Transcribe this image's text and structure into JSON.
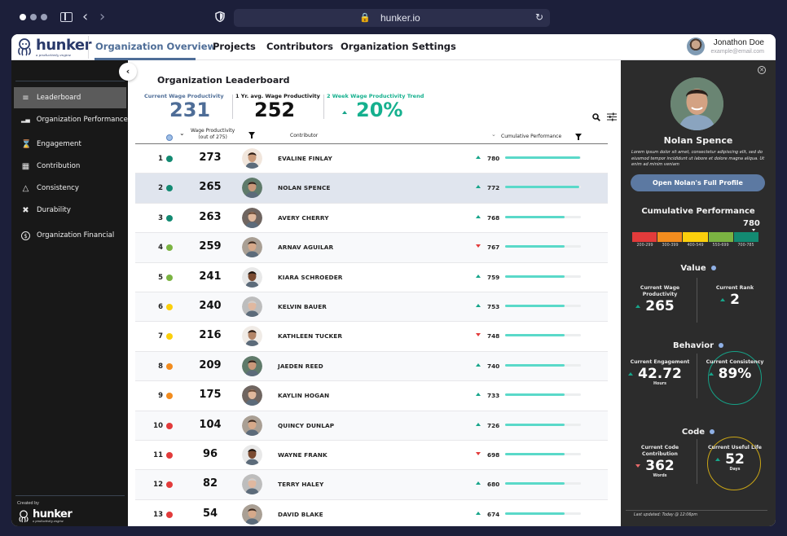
{
  "browser": {
    "url": "hunker.io"
  },
  "app": {
    "logo_text": "hunker",
    "logo_tagline": "a productivity engine",
    "nav": [
      {
        "label": "Organization Overview",
        "active": true
      },
      {
        "label": "Projects",
        "active": false
      },
      {
        "label": "Contributors",
        "active": false
      },
      {
        "label": "Organization Settings",
        "active": false
      }
    ],
    "user": {
      "name": "Jonathon Doe",
      "email": "example@email.com"
    }
  },
  "sidebar": {
    "items": [
      {
        "label": "Leaderboard",
        "icon": "leaderboard-icon",
        "active": true
      },
      {
        "label": "Organization Performance",
        "icon": "bar-chart-icon",
        "active": false
      },
      {
        "label": "Engagement",
        "icon": "hourglass-icon",
        "active": false
      },
      {
        "label": "Contribution",
        "icon": "blocks-icon",
        "active": false
      },
      {
        "label": "Consistency",
        "icon": "metronome-icon",
        "active": false
      },
      {
        "label": "Durability",
        "icon": "durability-icon",
        "active": false
      },
      {
        "label": "Organization Financial",
        "icon": "dollar-circle-icon",
        "active": false
      }
    ],
    "created_by": "Created by",
    "footer_logo": "hunker",
    "footer_tagline": "a productivity engine"
  },
  "main": {
    "title": "Organization Leaderboard",
    "kpis": [
      {
        "label": "Current Wage Productivity",
        "value": "231",
        "color": "#4e6d97"
      },
      {
        "label": "1 Yr. avg. Wage Productivity",
        "value": "252",
        "color": "#111111"
      },
      {
        "label": "2 Week Wage Productivity  Trend",
        "value": "20%",
        "color": "#15b08e",
        "trend": "up"
      }
    ],
    "columns": {
      "wage": "Wage Productivity",
      "wage_sub": "(out of 275)",
      "contributor": "Contributor",
      "performance": "Cumulative Performance"
    },
    "performance_max": 785,
    "rows": [
      {
        "rank": "1",
        "status": "#138a72",
        "wage": "273",
        "name": "EVALINE FINLAY",
        "trend": "up",
        "perf": 780,
        "selected": false
      },
      {
        "rank": "2",
        "status": "#138a72",
        "wage": "265",
        "name": "NOLAN SPENCE",
        "trend": "up",
        "perf": 772,
        "selected": true
      },
      {
        "rank": "3",
        "status": "#138a72",
        "wage": "263",
        "name": "AVERY CHERRY",
        "trend": "up",
        "perf": 768,
        "selected": false
      },
      {
        "rank": "4",
        "status": "#7bb342",
        "wage": "259",
        "name": "ARNAV AGUILAR",
        "trend": "down",
        "perf": 767,
        "selected": false
      },
      {
        "rank": "5",
        "status": "#7bb342",
        "wage": "241",
        "name": "KIARA SCHROEDER",
        "trend": "up",
        "perf": 759,
        "selected": false
      },
      {
        "rank": "6",
        "status": "#fbcf0c",
        "wage": "240",
        "name": "KELVIN BAUER",
        "trend": "up",
        "perf": 753,
        "selected": false
      },
      {
        "rank": "7",
        "status": "#fbcf0c",
        "wage": "216",
        "name": "KATHLEEN TUCKER",
        "trend": "down",
        "perf": 748,
        "selected": false
      },
      {
        "rank": "8",
        "status": "#f28c1e",
        "wage": "209",
        "name": "JAEDEN REED",
        "trend": "up",
        "perf": 740,
        "selected": false
      },
      {
        "rank": "9",
        "status": "#f28c1e",
        "wage": "175",
        "name": "KAYLIN HOGAN",
        "trend": "up",
        "perf": 733,
        "selected": false
      },
      {
        "rank": "10",
        "status": "#e23b3b",
        "wage": "104",
        "name": "QUINCY DUNLAP",
        "trend": "up",
        "perf": 726,
        "selected": false
      },
      {
        "rank": "11",
        "status": "#e23b3b",
        "wage": "96",
        "name": "WAYNE FRANK",
        "trend": "down",
        "perf": 698,
        "selected": false
      },
      {
        "rank": "12",
        "status": "#e23b3b",
        "wage": "82",
        "name": "TERRY HALEY",
        "trend": "up",
        "perf": 680,
        "selected": false
      },
      {
        "rank": "13",
        "status": "#e23b3b",
        "wage": "54",
        "name": "DAVID BLAKE",
        "trend": "up",
        "perf": 674,
        "selected": false
      }
    ]
  },
  "panel": {
    "name": "Nolan Spence",
    "description": "Lorem ipsum dolor sit amet, consectetur adipiscing elit, sed do eiusmod tempor incididunt ut labore et dolore magna aliqua. Ut enim ad minim veniam",
    "profile_button": "Open Nolan's Full Profile",
    "cumulative_title": "Cumulative Performance",
    "cumulative_value": "780",
    "scale": [
      {
        "label": "200-299",
        "color": "#e23b3b"
      },
      {
        "label": "300-399",
        "color": "#f28c1e"
      },
      {
        "label": "400-549",
        "color": "#fbcf0c"
      },
      {
        "label": "550-699",
        "color": "#7bb342"
      },
      {
        "label": "700-785",
        "color": "#138a72"
      }
    ],
    "sections": {
      "value": {
        "title": "Value",
        "left": {
          "label": "Current Wage Productivity",
          "value": "265",
          "trend": "up",
          "unit": ""
        },
        "right": {
          "label": "Current Rank",
          "value": "2",
          "trend": "up",
          "unit": ""
        }
      },
      "behavior": {
        "title": "Behavior",
        "left": {
          "label": "Current Engagement",
          "value": "42.72",
          "trend": "up",
          "unit": "Hours"
        },
        "right": {
          "label": "Current Consistency",
          "value": "89%",
          "trend": "up",
          "unit": "",
          "ring_color": "#16a086"
        }
      },
      "code": {
        "title": "Code",
        "left": {
          "label": "Current Code Contribution",
          "value": "362",
          "trend": "down",
          "unit": "Words"
        },
        "right": {
          "label": "Current Useful Life",
          "value": "52",
          "trend": "up",
          "unit": "Days",
          "ring_color": "#c9a516"
        }
      }
    },
    "last_updated": "Last updated: Today @ 12:06pm"
  }
}
